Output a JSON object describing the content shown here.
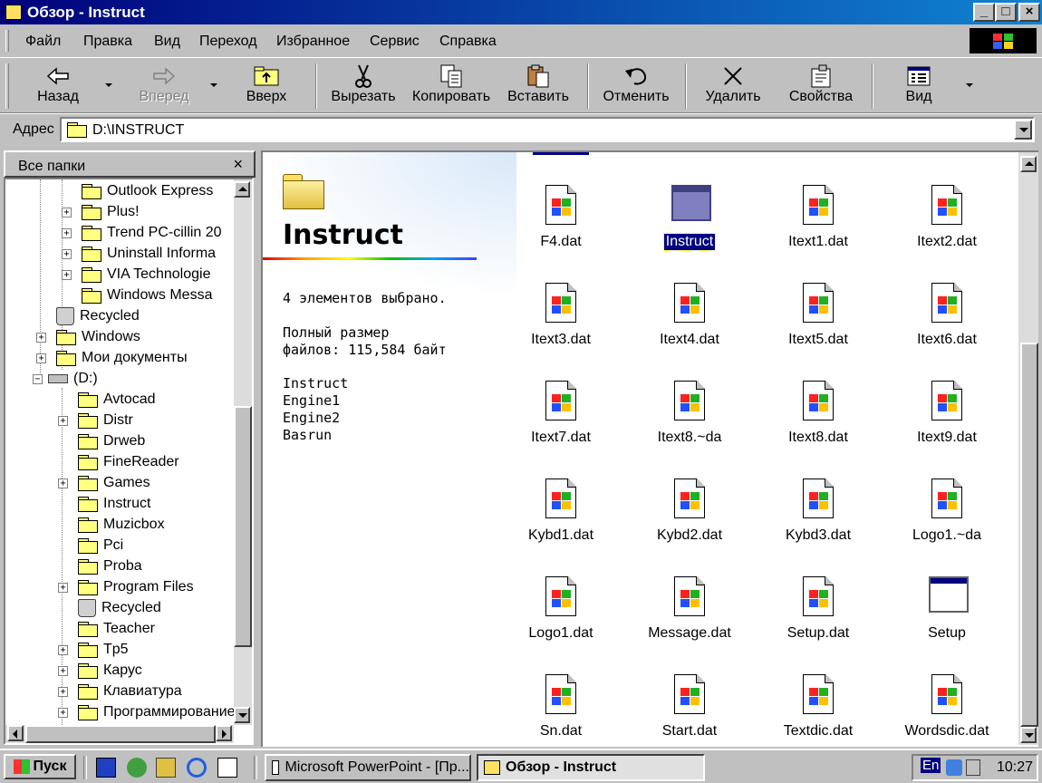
{
  "window": {
    "title": "Обзор - Instruct",
    "btn_min": "_",
    "btn_max": "□",
    "btn_close": "×"
  },
  "menu": [
    "Файл",
    "Правка",
    "Вид",
    "Переход",
    "Избранное",
    "Сервис",
    "Справка"
  ],
  "toolbar": {
    "back": "Назад",
    "forward": "Вперед",
    "up": "Вверх",
    "cut": "Вырезать",
    "copy": "Копировать",
    "paste": "Вставить",
    "undo": "Отменить",
    "delete": "Удалить",
    "properties": "Свойства",
    "view": "Вид"
  },
  "address": {
    "label": "Адрес",
    "value": "D:\\INSTRUCT"
  },
  "folders": {
    "header": "Все папки",
    "close": "×",
    "items": [
      "Outlook Express",
      "Plus!",
      "Trend PC-cillin 20",
      "Uninstall Informa",
      "VIA Technologie",
      "Windows Messa",
      "Recycled",
      "Windows",
      "Мои документы",
      "(D:)",
      "Avtocad",
      "Distr",
      "Drweb",
      "FineReader",
      "Games",
      "Instruct",
      "Muzicbox",
      "Pci",
      "Proba",
      "Program Files",
      "Recycled",
      "Teacher",
      "Tp5",
      "Карус",
      "Клавиатура",
      "Программирование"
    ]
  },
  "info": {
    "title": "Instruct",
    "selected": "4 элементов выбрано.",
    "size_line1": "Полный размер",
    "size_line2": "файлов: 115,584 байт",
    "names": [
      "Instruct",
      "Engine1",
      "Engine2",
      "Basrun"
    ]
  },
  "files": [
    "F4.dat",
    "Instruct",
    "Itext1.dat",
    "Itext2.dat",
    "Itext3.dat",
    "Itext4.dat",
    "Itext5.dat",
    "Itext6.dat",
    "Itext7.dat",
    "Itext8.~da",
    "Itext8.dat",
    "Itext9.dat",
    "Kybd1.dat",
    "Kybd2.dat",
    "Kybd3.dat",
    "Logo1.~da",
    "Logo1.dat",
    "Message.dat",
    "Setup.dat",
    "Setup",
    "Sn.dat",
    "Start.dat",
    "Textdic.dat",
    "Wordsdic.dat"
  ],
  "taskbar": {
    "start": "Пуск",
    "task1": "Microsoft PowerPoint - [Пр...",
    "task2": "Обзор - Instruct",
    "lang": "En",
    "time": "10:27"
  }
}
